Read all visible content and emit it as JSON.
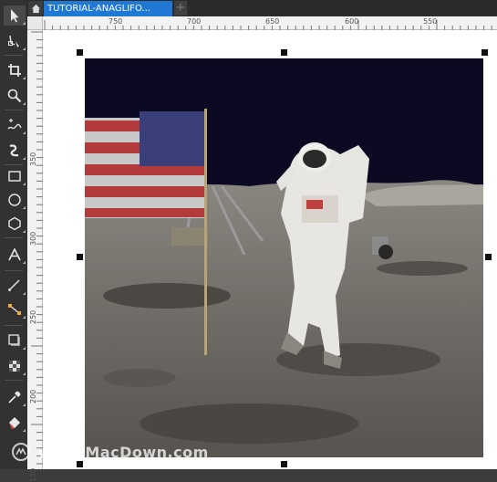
{
  "tabs": {
    "home_icon": "home-icon",
    "document_tab": "TUTORIAL-ANAGLIFO...",
    "add_tab": "+"
  },
  "rulers": {
    "horizontal": [
      "750",
      "700",
      "650",
      "600",
      "550"
    ],
    "vertical": [
      "350",
      "300",
      "250",
      "200",
      "150"
    ]
  },
  "toolbox": [
    {
      "name": "pick-tool-icon"
    },
    {
      "name": "shape-tool-icon"
    },
    {
      "name": "crop-tool-icon"
    },
    {
      "name": "zoom-tool-icon"
    },
    {
      "name": "freehand-tool-icon"
    },
    {
      "name": "artistic-media-tool-icon"
    },
    {
      "name": "rectangle-tool-icon"
    },
    {
      "name": "ellipse-tool-icon"
    },
    {
      "name": "polygon-tool-icon"
    },
    {
      "name": "text-tool-icon"
    },
    {
      "name": "parallel-dimension-tool-icon"
    },
    {
      "name": "connector-tool-icon"
    },
    {
      "name": "drop-shadow-tool-icon"
    },
    {
      "name": "transparency-tool-icon"
    },
    {
      "name": "eyedropper-tool-icon"
    },
    {
      "name": "interactive-fill-tool-icon"
    }
  ],
  "watermark": {
    "text": "www.MacDown.com"
  },
  "colors": {
    "accent": "#1e78d4",
    "toolbox": "#323232",
    "moon_sky": "#0c0a22"
  }
}
